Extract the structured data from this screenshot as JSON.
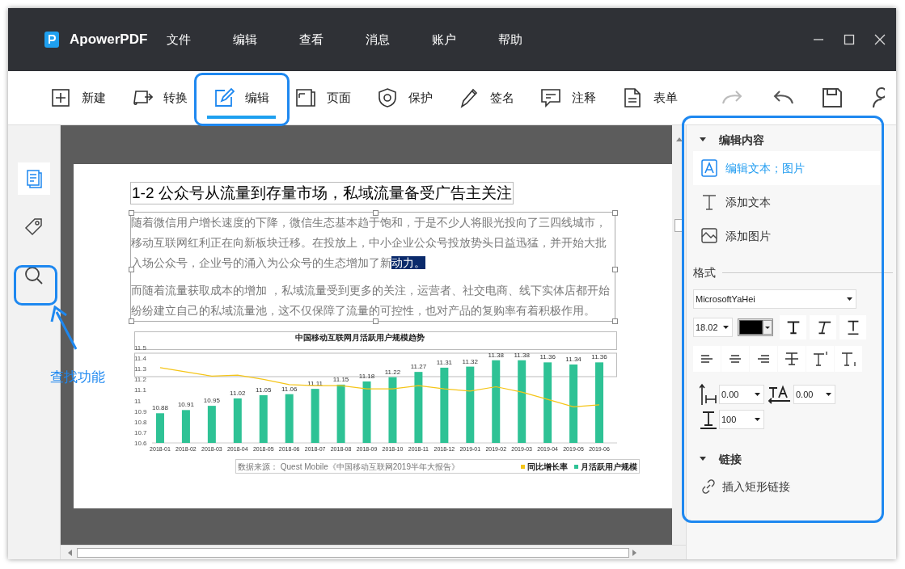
{
  "window": {
    "app_name": "ApowerPDF"
  },
  "menu": [
    "文件",
    "编辑",
    "查看",
    "消息",
    "账户",
    "帮助"
  ],
  "toolbar": [
    {
      "kind": "new",
      "label": "新建",
      "selected": false
    },
    {
      "kind": "convert",
      "label": "转换",
      "selected": false
    },
    {
      "kind": "edit",
      "label": "编辑",
      "selected": true
    },
    {
      "kind": "page",
      "label": "页面",
      "selected": false
    },
    {
      "kind": "protect",
      "label": "保护",
      "selected": false
    },
    {
      "kind": "sign",
      "label": "签名",
      "selected": false
    },
    {
      "kind": "comment",
      "label": "注释",
      "selected": false
    },
    {
      "kind": "form",
      "label": "表单",
      "selected": false
    }
  ],
  "sidebar": [
    {
      "kind": "pages",
      "selected": true
    },
    {
      "kind": "tag",
      "selected": false
    },
    {
      "kind": "search",
      "selected": false
    }
  ],
  "callout": {
    "text": "查找功能"
  },
  "document": {
    "heading": "1-2 公众号从流量到存量市场，私域流量备受广告主关注",
    "paragraphs": [
      {
        "text": "随着微信用户增长速度的下降，微信生态基本趋于饱和，于是不少人将眼光投向了三四线城市，移动互联网红利正在向新板块迁移。在投放上，中小企业公众号投放势头日益迅猛，并开始大批入场公众号，企业号的涌入为公众号的生态增加了新",
        "selected_text": "动力。"
      },
      {
        "text": "而随着流量获取成本的增加 ，私域流量受到更多的关注，运营者、社交电商、线下实体店都开始纷纷建立自己的私域流量池，这不仅保障了流量的可控性，也对产品的复购率有着积极作用。"
      }
    ],
    "chart_data": {
      "type": "bar",
      "title": "中国移动互联网月活跃用户规模趋势",
      "categories": [
        "2018-01",
        "2018-02",
        "2018-03",
        "2018-04",
        "2018-05",
        "2018-06",
        "2018-07",
        "2018-08",
        "2018-09",
        "2018-10",
        "2018-11",
        "2018-12",
        "2019-01",
        "2019-02",
        "2019-03",
        "2019-04",
        "2019-05",
        "2019-06"
      ],
      "series": [
        {
          "name": "同比增长率",
          "type": "line",
          "color": "#f5c518",
          "values": [
            11.31,
            11.27,
            11.23,
            11.24,
            11.2,
            11.15,
            11.14,
            11.14,
            11.11,
            11.11,
            11.14,
            11.11,
            11.09,
            11.13,
            11.08,
            11.01,
            10.94,
            10.96
          ]
        },
        {
          "name": "月活跃用户规模",
          "type": "bar",
          "color": "#2ec295",
          "values": [
            10.88,
            10.91,
            10.95,
            11.02,
            11.05,
            11.06,
            11.11,
            11.15,
            11.18,
            11.22,
            11.27,
            11.31,
            11.32,
            11.38,
            11.38,
            11.36,
            11.34,
            11.36
          ],
          "value_labels": [
            "10.88",
            "10.91",
            "10.95",
            "11.02",
            "11.05",
            "11.06",
            "11.11",
            "11.15",
            "11.18",
            "11.22",
            "11.27",
            "11.31",
            "11.32",
            "11.38",
            "11.38",
            "11.36",
            "11.34",
            "11.36"
          ]
        }
      ],
      "ylim": [
        10.6,
        11.5
      ],
      "yticks": [
        10.6,
        10.7,
        10.8,
        10.9,
        {
          "value": 11,
          "label": "11"
        },
        11.1,
        11.2,
        11.3,
        11.4,
        11.5
      ]
    },
    "chart_source": "数据来源： Quest Mobile《中国移动互联网2019半年大报告》"
  },
  "panel": {
    "edit_section": {
      "title": "编辑内容",
      "expanded": true,
      "items": [
        {
          "kind": "edit",
          "label": "编辑文本；图片",
          "selected": true
        },
        {
          "kind": "text",
          "label": "添加文本",
          "selected": false
        },
        {
          "kind": "image",
          "label": "添加图片",
          "selected": false
        }
      ]
    },
    "format": {
      "title": "格式",
      "font": "MicrosoftYaHei",
      "size": "18.02",
      "color": "#000000",
      "line_spacing": "0.00",
      "char_spacing": "0.00",
      "scale": "100"
    },
    "link_section": {
      "title": "链接",
      "expanded": true,
      "items": [
        {
          "label": "插入矩形链接"
        }
      ]
    }
  }
}
